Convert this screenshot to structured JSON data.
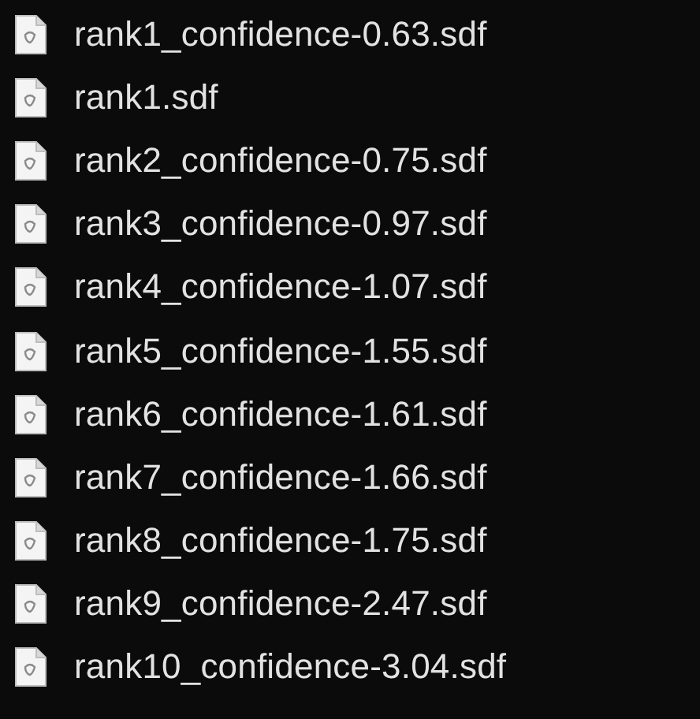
{
  "files": [
    {
      "name": "rank1_confidence-0.63.sdf"
    },
    {
      "name": "rank1.sdf"
    },
    {
      "name": "rank2_confidence-0.75.sdf"
    },
    {
      "name": "rank3_confidence-0.97.sdf"
    },
    {
      "name": "rank4_confidence-1.07.sdf"
    },
    {
      "name": "rank5_confidence-1.55.sdf"
    },
    {
      "name": "rank6_confidence-1.61.sdf"
    },
    {
      "name": "rank7_confidence-1.66.sdf"
    },
    {
      "name": "rank8_confidence-1.75.sdf"
    },
    {
      "name": "rank9_confidence-2.47.sdf"
    },
    {
      "name": "rank10_confidence-3.04.sdf"
    }
  ]
}
